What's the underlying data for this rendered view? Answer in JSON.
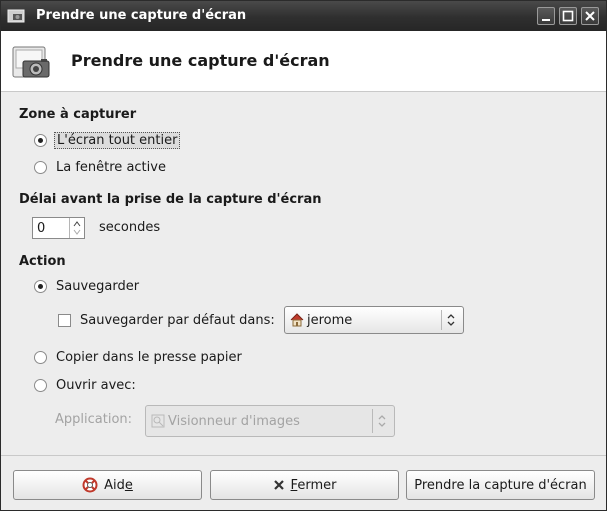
{
  "window": {
    "title": "Prendre une capture d'écran"
  },
  "header": {
    "title": "Prendre une capture d'écran"
  },
  "zone": {
    "title": "Zone à capturer",
    "options": [
      "L'écran tout entier",
      "La fenêtre active"
    ],
    "selected": 0
  },
  "delay": {
    "title": "Délai avant la prise de la capture d'écran",
    "value": "0",
    "unit": "secondes"
  },
  "action": {
    "title": "Action",
    "save_label": "Sauvegarder",
    "save_default_label": "Sauvegarder par défaut dans:",
    "folder_value": "jerome",
    "copy_label": "Copier dans le presse papier",
    "open_with_label": "Ouvrir avec:",
    "application_label": "Application:",
    "application_value": "Visionneur d'images"
  },
  "buttons": {
    "help_prefix": "Aid",
    "help_mnemonic": "e",
    "close_mnemonic": "F",
    "close_rest": "ermer",
    "take_label": "Prendre la capture d'écran"
  },
  "colors": {
    "titlebar": "#2f2f2f",
    "background": "#ededed"
  }
}
